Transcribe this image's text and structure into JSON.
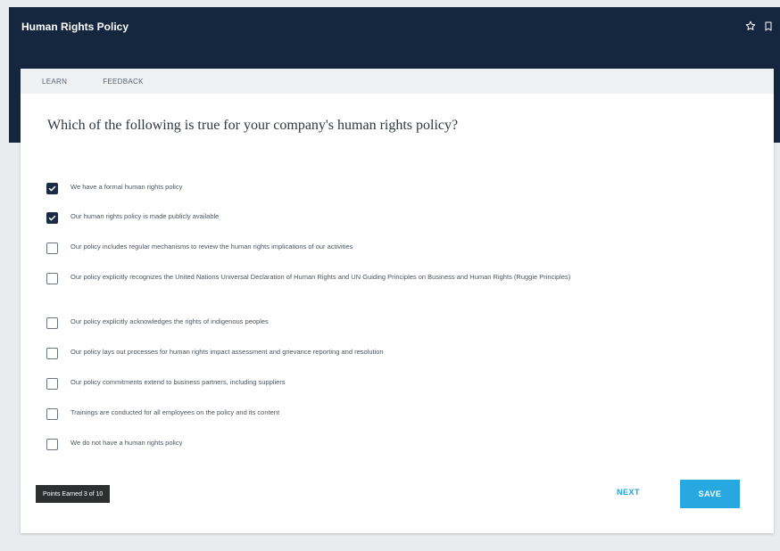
{
  "header": {
    "title": "Human Rights Policy",
    "icons": [
      "star-icon",
      "bookmark-icon"
    ],
    "background": "#15263f"
  },
  "tabs": [
    {
      "label": "LEARN"
    },
    {
      "label": "FEEDBACK"
    }
  ],
  "question": "Which of the following is true for your company's human rights policy?",
  "options": [
    {
      "label": "We have a formal human rights policy",
      "checked": true
    },
    {
      "label": "Our human rights policy is made publicly available",
      "checked": true
    },
    {
      "label": "Our policy includes regular mechanisms to review the human rights implications of our activities",
      "checked": false
    },
    {
      "label": "Our policy explicitly recognizes the United Nations Universal Declaration of Human Rights and UN Guiding Principles on Business and Human Rights (Ruggie Principles)",
      "checked": false
    },
    {
      "label": "Our policy explicitly acknowledges the rights of indigenous peoples",
      "checked": false
    },
    {
      "label": "Our policy lays out processes for human rights impact assessment and grievance reporting and resolution",
      "checked": false
    },
    {
      "label": "Our policy commitments extend to business partners, including suppliers",
      "checked": false
    },
    {
      "label": "Trainings are conducted for all employees on the policy and its content",
      "checked": false
    },
    {
      "label": "We do not have a human rights policy",
      "checked": false
    }
  ],
  "progress": {
    "label": "Points Earned 3 of 10"
  },
  "actions": {
    "next_label": "NEXT",
    "save_label": "SAVE",
    "accent": "#28a8e0"
  }
}
